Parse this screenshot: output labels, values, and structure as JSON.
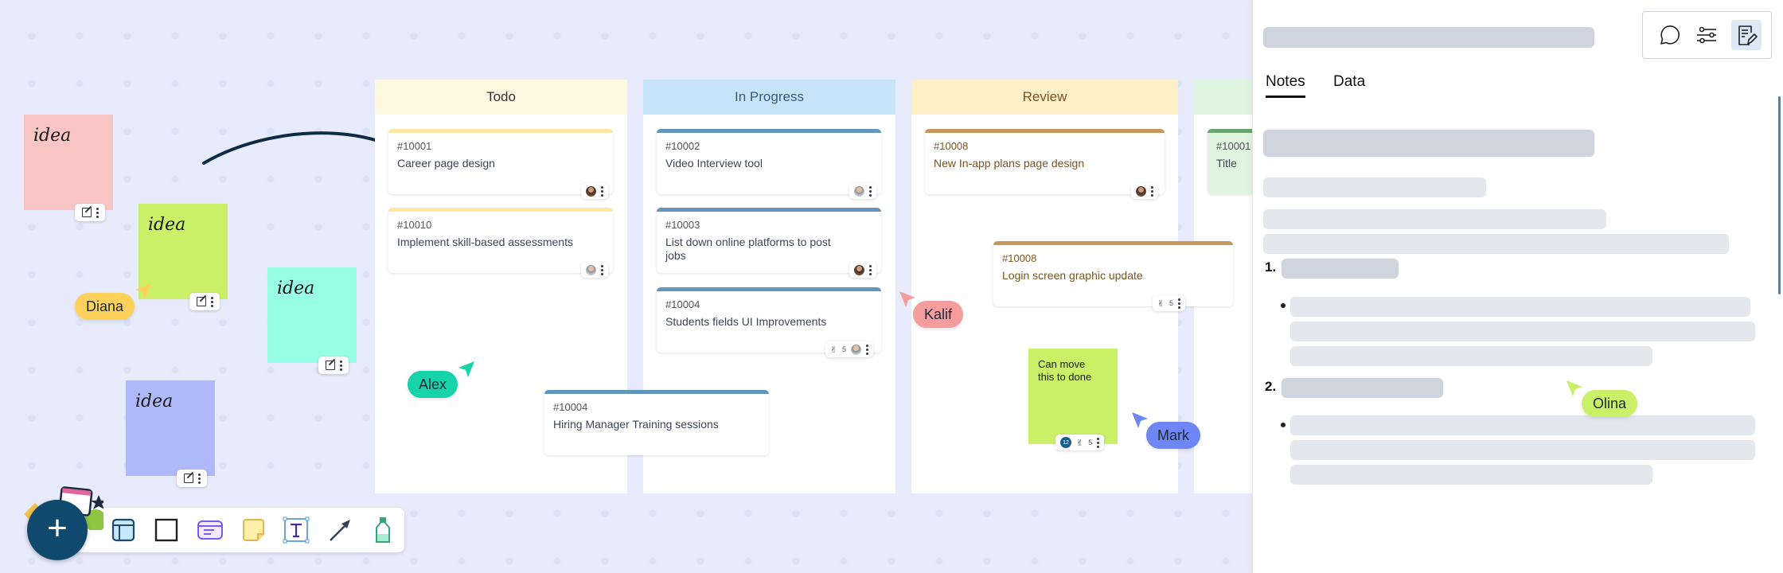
{
  "stickies": [
    {
      "text": "idea",
      "color": "#f9c4c4"
    },
    {
      "text": "idea",
      "color": "#c9f066"
    },
    {
      "text": "idea",
      "color": "#97fde5"
    },
    {
      "text": "idea",
      "color": "#aeb9fb"
    }
  ],
  "note_sticky": {
    "text": "Can move this to done",
    "color": "#c9f066",
    "comments": "12",
    "reactions": "5"
  },
  "columns": [
    {
      "title": "Todo",
      "head_color": "#fff8e1",
      "title_color": "#333333"
    },
    {
      "title": "In Progress",
      "head_color": "#c6e3f8",
      "title_color": "#3a5a78"
    },
    {
      "title": "Review",
      "head_color": "#fdf0c8",
      "title_color": "#7a5521"
    },
    {
      "title": "",
      "head_color": "#dff5e0",
      "title_color": "#333333"
    }
  ],
  "cards": {
    "todo": [
      {
        "id": "#10001",
        "title": "Career page design"
      },
      {
        "id": "#10010",
        "title": "Implement skill-based assessments"
      }
    ],
    "in_progress": [
      {
        "id": "#10002",
        "title": "Video Interview tool"
      },
      {
        "id": "#10003",
        "title": "List down online platforms to post jobs"
      },
      {
        "id": "#10004",
        "title": "Students fields UI Improvements",
        "reactions": "5"
      }
    ],
    "review": [
      {
        "id": "#10008",
        "title": "New In-app plans page design"
      }
    ],
    "done": [
      {
        "id": "#10001",
        "title": "Title"
      }
    ],
    "floating": [
      {
        "id": "#10004",
        "title": "Hiring Manager Training sessions"
      },
      {
        "id": "#10008",
        "title": "Login screen graphic update",
        "reactions": "5"
      }
    ]
  },
  "cursors": [
    {
      "name": "Diana",
      "color": "#fdd15a"
    },
    {
      "name": "Alex",
      "color": "#17d3a8"
    },
    {
      "name": "Kalif",
      "color": "#f59c9c"
    },
    {
      "name": "Mark",
      "color": "#6f86f7"
    },
    {
      "name": "Olina",
      "color": "#c9f066"
    }
  ],
  "panel": {
    "tabs": [
      {
        "label": "Notes",
        "active": true
      },
      {
        "label": "Data",
        "active": false
      }
    ],
    "list_markers": [
      "1.",
      "2."
    ],
    "icons": [
      "comment-icon",
      "sliders-icon",
      "notes-edit-icon"
    ]
  },
  "toolbar": {
    "add_label": "+",
    "tools": [
      "frame-tool",
      "rectangle-tool",
      "card-tool",
      "sticky-note-tool",
      "text-tool",
      "arrow-tool",
      "marker-tool"
    ]
  }
}
